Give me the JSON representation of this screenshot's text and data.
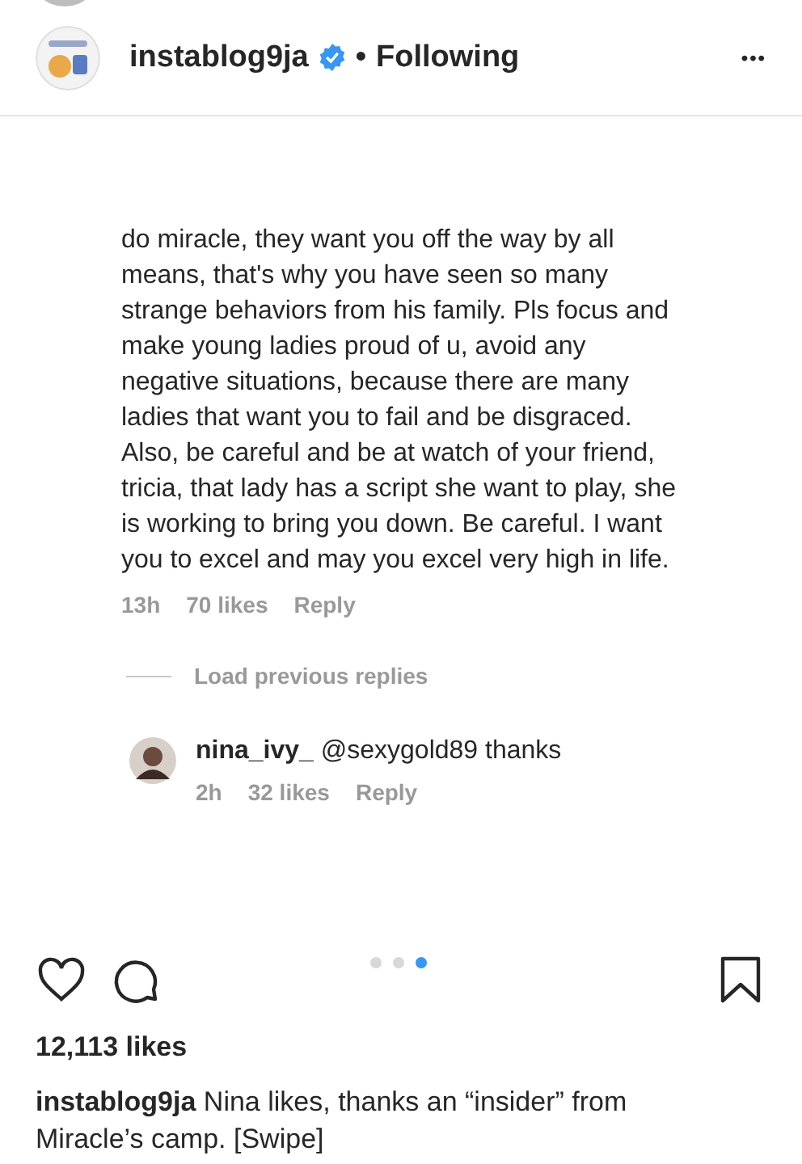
{
  "header": {
    "username": "instablog9ja",
    "verified": true,
    "separator": "•",
    "follow_status": "Following",
    "more": "•••"
  },
  "post": {
    "comment": {
      "text": "do miracle, they want you off the way by all means, that's why you have seen so many strange behaviors from his family. Pls focus and make young ladies proud of u, avoid any negative situations, because there are many ladies that want you to fail and be disgraced. Also, be careful and be at watch of your friend, tricia, that lady has a script she want to play, she is working to bring you down. Be careful. I want you to excel and may you excel very high in life.",
      "time": "13h",
      "likes": "70 likes",
      "reply": "Reply"
    },
    "load_previous": "Load previous replies",
    "reply": {
      "username": "nina_ivy_",
      "text": "@sexygold89 thanks",
      "time": "2h",
      "likes": "32 likes",
      "reply": "Reply"
    }
  },
  "carousel": [
    {
      "selected": false
    },
    {
      "selected": false
    },
    {
      "selected": true
    }
  ],
  "likes": "12,113 likes",
  "caption": {
    "username": "instablog9ja",
    "text": "Nina likes, thanks an “insider” from Miracle’s camp. [Swipe]"
  }
}
